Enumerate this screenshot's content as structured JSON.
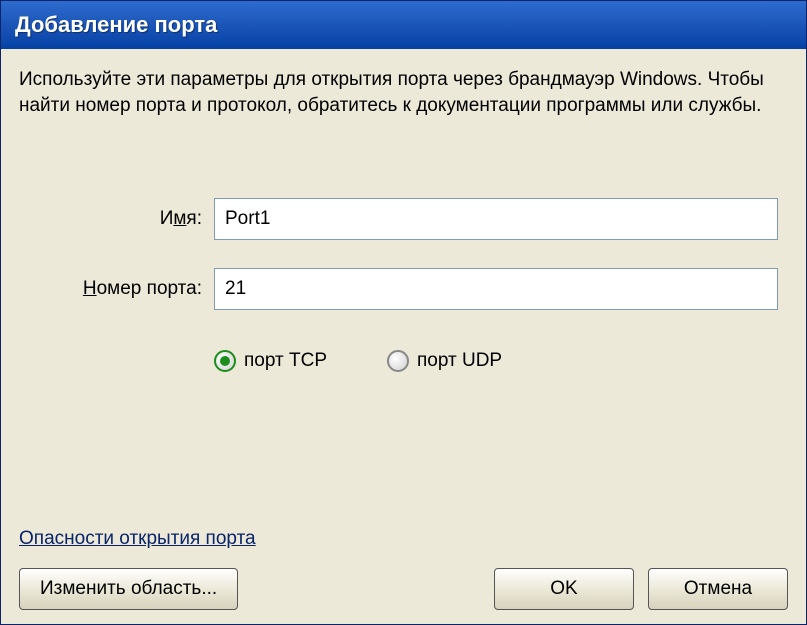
{
  "title": "Добавление порта",
  "description": "Используйте эти параметры для открытия порта через брандмауэр Windows. Чтобы найти номер порта и протокол, обратитесь к документации программы или службы.",
  "fields": {
    "name": {
      "label_pre": "И",
      "label_u": "м",
      "label_post": "я:",
      "value": "Port1"
    },
    "port": {
      "label_u": "Н",
      "label_post": "омер порта:",
      "value": "21"
    }
  },
  "radios": {
    "tcp": {
      "label_u": "п",
      "label_post": "орт TCP",
      "checked": true
    },
    "udp": {
      "label_post": "порт UDP",
      "checked": false
    }
  },
  "link": "Опасности открытия порта",
  "buttons": {
    "scope": {
      "u": "И",
      "post": "зменить область..."
    },
    "ok": "OK",
    "cancel": "Отмена"
  }
}
